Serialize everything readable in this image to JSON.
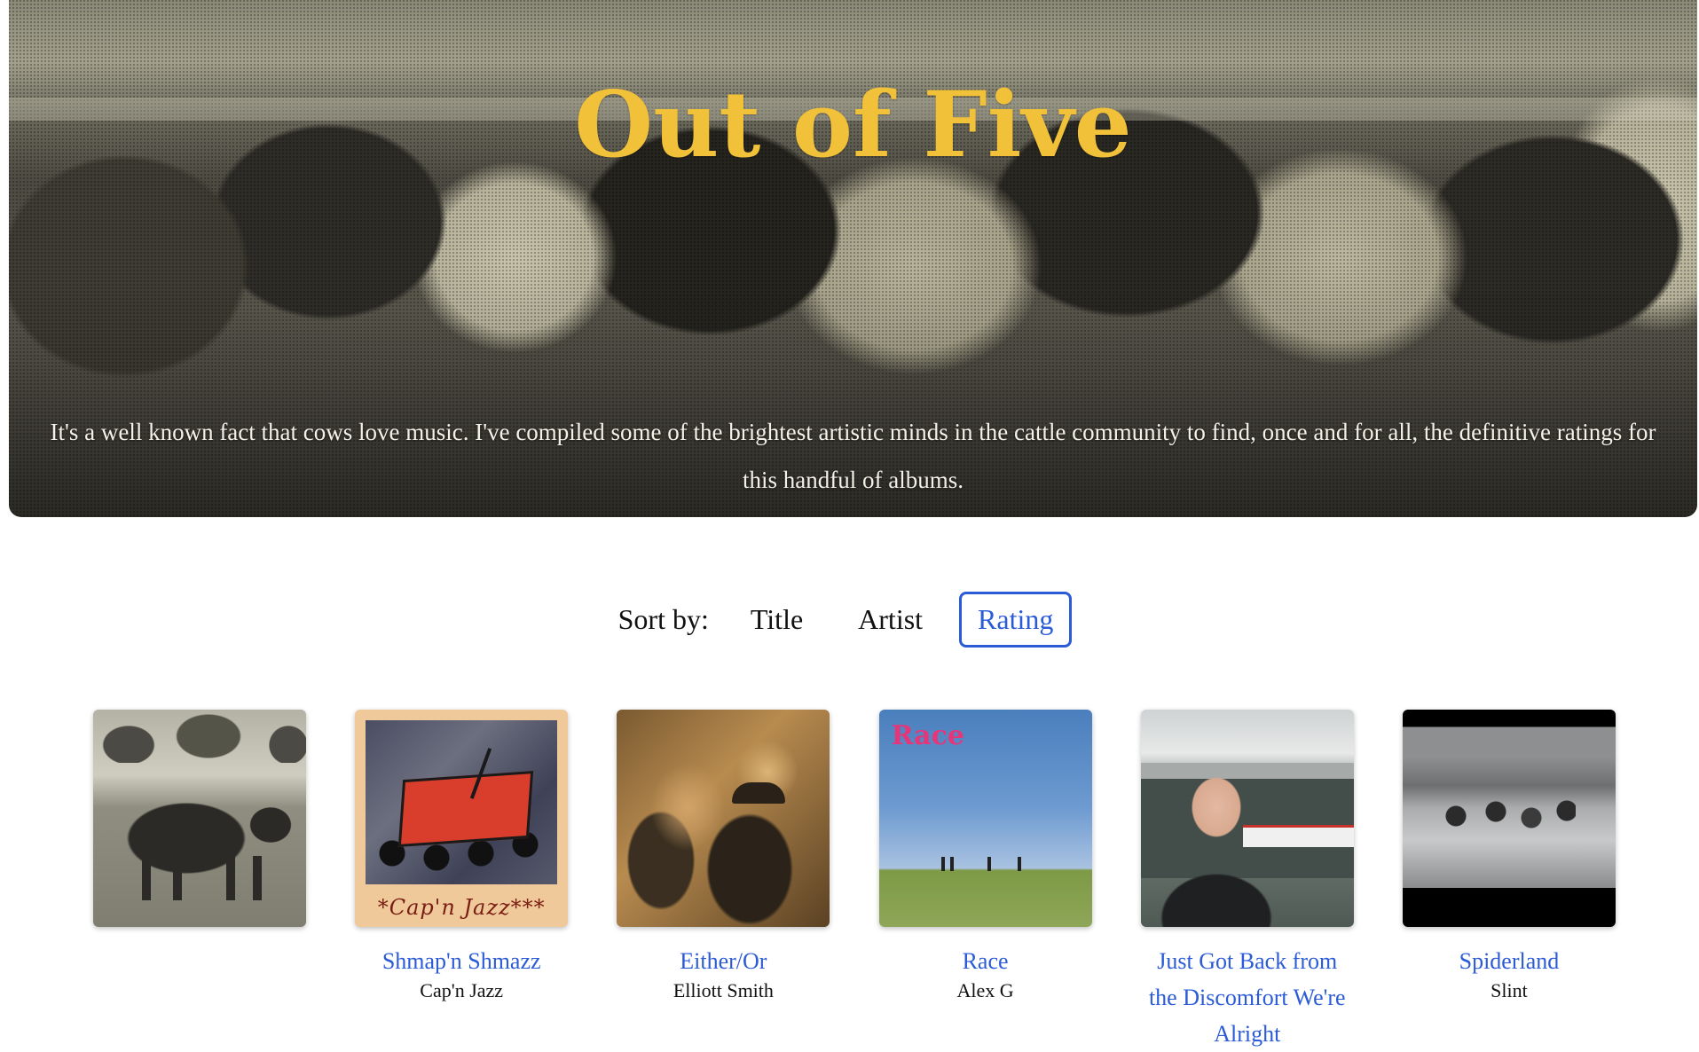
{
  "hero": {
    "title": "Out of Five",
    "description": "It's a well known fact that cows love music. I've compiled some of the brightest artistic minds in the cattle community to find, once and for all, the definitive ratings for this handful of albums."
  },
  "sort": {
    "label": "Sort by:",
    "options": [
      "Title",
      "Artist",
      "Rating"
    ],
    "active": "Rating"
  },
  "albums": [
    {
      "title": "",
      "artist": ""
    },
    {
      "title": "Shmap'n Shmazz",
      "artist": "Cap'n Jazz",
      "cover_text": "*Cap'n Jazz***"
    },
    {
      "title": "Either/Or",
      "artist": "Elliott Smith"
    },
    {
      "title": "Race",
      "artist": "Alex G",
      "cover_text": "Race"
    },
    {
      "title": "Just Got Back from the Discomfort We're Alright",
      "artist": ""
    },
    {
      "title": "Spiderland",
      "artist": "Slint"
    }
  ],
  "colors": {
    "accent": "#2b5bd6",
    "title_gold": "#f2c13a"
  }
}
